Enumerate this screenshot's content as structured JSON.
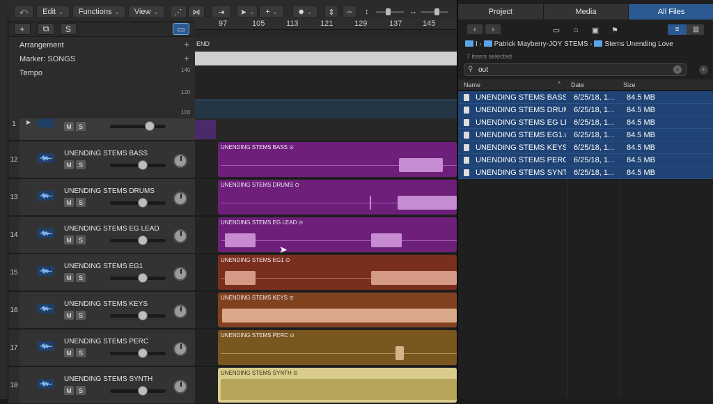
{
  "toolbar": {
    "edit": "Edit",
    "functions": "Functions",
    "view": "View"
  },
  "tracklist_header": {
    "add": "+",
    "solo": "S"
  },
  "ruler": {
    "ticks": [
      "97",
      "105",
      "113",
      "121",
      "129",
      "137",
      "145"
    ],
    "end_marker": "END"
  },
  "globals": {
    "arrangement": "Arrangement",
    "marker": "Marker: SONGS",
    "tempo": "Tempo",
    "tempo_values": [
      "140",
      "120",
      "100"
    ]
  },
  "folder_track": {
    "number": "1",
    "mute": "M",
    "solo": "S"
  },
  "tracks": [
    {
      "number": "12",
      "name": "UNENDING STEMS BASS",
      "mute": "M",
      "solo": "S",
      "region": "UNENDING STEMS BASS",
      "color": "#6d1f7a",
      "wave": "#c68bd1"
    },
    {
      "number": "13",
      "name": "UNENDING STEMS DRUMS",
      "mute": "M",
      "solo": "S",
      "region": "UNENDING STEMS DRUMS",
      "color": "#6d1f7a",
      "wave": "#c68bd1"
    },
    {
      "number": "14",
      "name": "UNENDING STEMS EG LEAD",
      "mute": "M",
      "solo": "S",
      "region": "UNENDING STEMS EG LEAD",
      "color": "#6d1f7a",
      "wave": "#c68bd1"
    },
    {
      "number": "15",
      "name": "UNENDING STEMS EG1",
      "mute": "M",
      "solo": "S",
      "region": "UNENDING STEMS EG1",
      "color": "#7a2f1d",
      "wave": "#d59a86"
    },
    {
      "number": "16",
      "name": "UNENDING STEMS KEYS",
      "mute": "M",
      "solo": "S",
      "region": "UNENDING STEMS KEYS",
      "color": "#80421e",
      "wave": "#d9a98a"
    },
    {
      "number": "17",
      "name": "UNENDING STEMS PERC",
      "mute": "M",
      "solo": "S",
      "region": "UNENDING STEMS PERC",
      "color": "#7b5720",
      "wave": "#d4b489"
    },
    {
      "number": "18",
      "name": "UNENDING STEMS SYNTH",
      "mute": "M",
      "solo": "S",
      "region": "UNENDING STEMS SYNTH",
      "color": "#d9cc8c",
      "wave": "#b7a55a"
    }
  ],
  "browser": {
    "tabs": [
      "Project",
      "Media",
      "All Files"
    ],
    "active_tab": "All Files",
    "crumbs": [
      "Patrick Mayberry-JOY STEMS",
      "Stems Unending Love"
    ],
    "crumb_prefix": "I",
    "selected_count": "7 items selected",
    "search_value": "out",
    "columns": {
      "name": "Name",
      "date": "Date",
      "size": "Size"
    },
    "files": [
      {
        "name": "UNENDING STEMS BASS.",
        "date": "6/25/18, 1...",
        "size": "84.5 MB"
      },
      {
        "name": "UNENDING STEMS DRUM",
        "date": "6/25/18, 1...",
        "size": "84.5 MB"
      },
      {
        "name": "UNENDING STEMS EG LE",
        "date": "6/25/18, 1...",
        "size": "84.5 MB"
      },
      {
        "name": "UNENDING STEMS EG1.w",
        "date": "6/25/18, 1...",
        "size": "84.5 MB"
      },
      {
        "name": "UNENDING STEMS KEYS.",
        "date": "6/25/18, 1...",
        "size": "84.5 MB"
      },
      {
        "name": "UNENDING STEMS PERC.",
        "date": "6/25/18, 1...",
        "size": "84.5 MB"
      },
      {
        "name": "UNENDING STEMS SYNT",
        "date": "6/25/18, 1...",
        "size": "84.5 MB"
      }
    ]
  }
}
